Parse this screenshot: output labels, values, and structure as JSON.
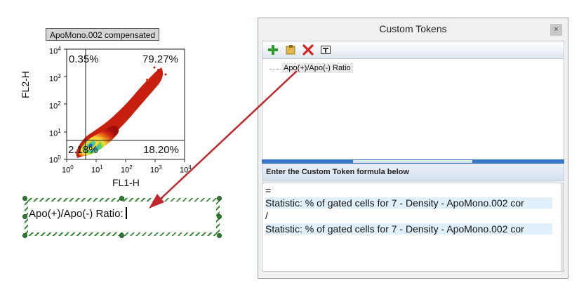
{
  "plot": {
    "title": "ApoMono.002 compensated",
    "x_label": "FL1-H",
    "y_label": "FL2-H",
    "x_ticks": [
      "10",
      "10",
      "10",
      "10",
      "10"
    ],
    "x_exps": [
      "0",
      "1",
      "2",
      "3",
      "4"
    ],
    "y_ticks": [
      "10",
      "10",
      "10",
      "10",
      "10"
    ],
    "y_exps": [
      "4",
      "3",
      "2",
      "1",
      "0"
    ],
    "quadrants": {
      "upper_left": "0.35%",
      "upper_right": "79.27%",
      "lower_left": "2.18%",
      "lower_right": "18.20%"
    }
  },
  "text_box": {
    "text": "Apo(+)/Apo(-) Ratio:"
  },
  "dialog": {
    "title": "Custom Tokens",
    "close_label": "×",
    "toolbar": {
      "add_icon": "plus-icon",
      "edit_icon": "folder-icon",
      "delete_icon": "x-icon",
      "text_icon": "text-format-icon"
    },
    "token_name": "Apo(+)/Apo(-) Ratio",
    "formula_header": "Enter the Custom Token formula below",
    "formula_lines": [
      "=",
      "Statistic: % of gated cells for 7 - Density - ApoMono.002 cor",
      "/",
      "Statistic: % of gated cells for 7 - Density - ApoMono.002 cor"
    ]
  },
  "colors": {
    "arrow": "#c0282d",
    "accent": "#3b78c8",
    "selection": "#3c8a3c"
  }
}
